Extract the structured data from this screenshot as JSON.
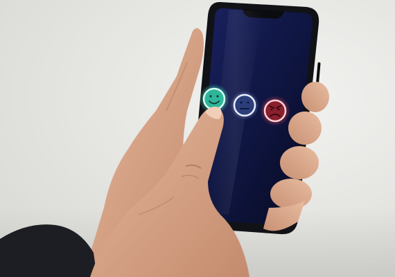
{
  "scene": {
    "description_colors": {
      "background": "#e6e6e3",
      "skin": "#d9a98c",
      "skin_shadow": "#b77e63",
      "sleeve": "#1d1e24",
      "phone_body": "#111216",
      "screen": "#0f1640"
    }
  },
  "feedback": {
    "options": [
      {
        "icon": "happy-face-icon",
        "color": "#2fb69a"
      },
      {
        "icon": "neutral-face-icon",
        "color": "#2c3f7a"
      },
      {
        "icon": "angry-face-icon",
        "color": "#8a1f2e"
      }
    ],
    "selected_index": 0
  }
}
